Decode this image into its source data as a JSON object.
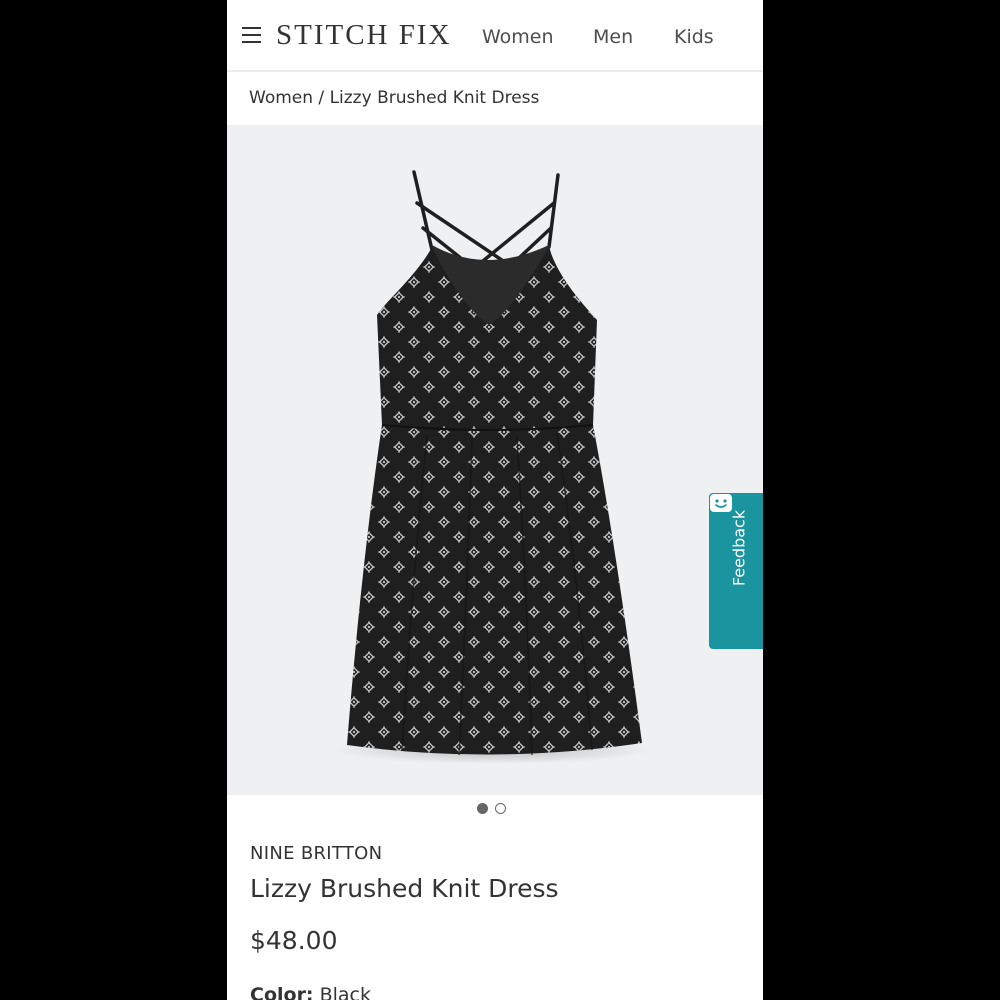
{
  "brand_logo": "STITCH FIX",
  "nav": {
    "items": [
      "Women",
      "Men",
      "Kids"
    ]
  },
  "breadcrumb": {
    "category": "Women",
    "separator": "/",
    "current": "Lizzy Brushed Knit Dress"
  },
  "gallery": {
    "image_count": 2,
    "active_index": 0,
    "background_color": "#eef0f2",
    "dress_color": "#1f1f1f",
    "pattern_color": "#e8e8e8"
  },
  "feedback_tab": {
    "label": "Feedback",
    "color": "#1a949e",
    "icon": "smiley-face-icon"
  },
  "product": {
    "brand": "NINE BRITTON",
    "name": "Lizzy Brushed Knit Dress",
    "price": "$48.00",
    "color_label": "Color:",
    "color_value": "Black"
  }
}
